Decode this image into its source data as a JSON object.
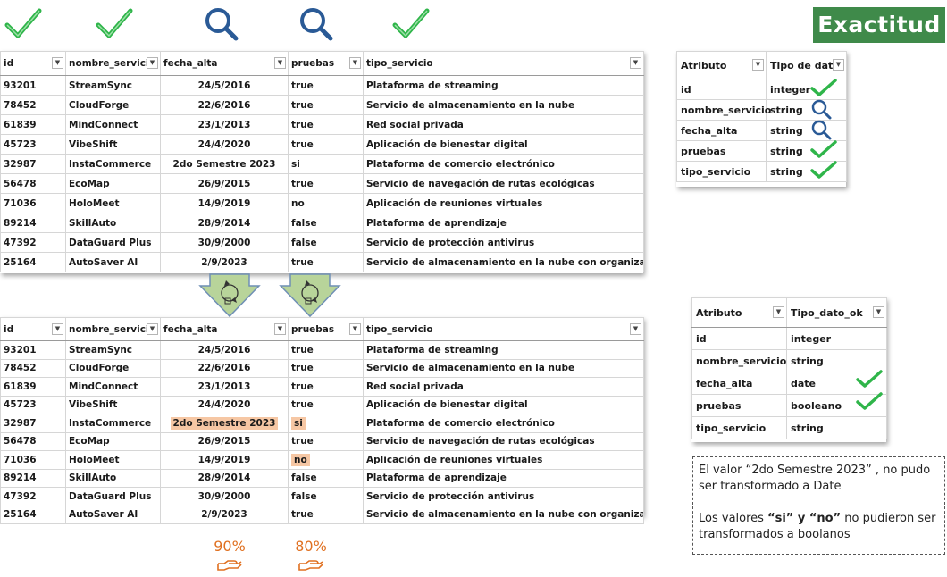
{
  "badge": "Exactitud",
  "header_icons": [
    "check-icon",
    "check-icon",
    "magnifier-icon",
    "magnifier-icon",
    "check-icon"
  ],
  "table": {
    "columns": [
      "id",
      "nombre_servicio",
      "fecha_alta",
      "pruebas",
      "tipo_servicio"
    ],
    "rows": [
      [
        "93201",
        "StreamSync",
        "24/5/2016",
        "true",
        "Plataforma de streaming"
      ],
      [
        "78452",
        "CloudForge",
        "22/6/2016",
        "true",
        "Servicio de almacenamiento en la nube"
      ],
      [
        "61839",
        "MindConnect",
        "23/1/2013",
        "true",
        "Red social privada"
      ],
      [
        "45723",
        "VibeShift",
        "24/4/2020",
        "true",
        "Aplicación de bienestar digital"
      ],
      [
        "32987",
        "InstaCommerce",
        "2do Semestre 2023",
        "si",
        "Plataforma de comercio electrónico"
      ],
      [
        "56478",
        "EcoMap",
        "26/9/2015",
        "true",
        "Servicio de navegación de rutas ecológicas"
      ],
      [
        "71036",
        "HoloMeet",
        "14/9/2019",
        "no",
        "Aplicación de reuniones virtuales"
      ],
      [
        "89214",
        "SkillAuto",
        "28/9/2014",
        "false",
        "Plataforma de aprendizaje"
      ],
      [
        "47392",
        "DataGuard Plus",
        "30/9/2000",
        "false",
        "Servicio de protección antivirus"
      ],
      [
        "25164",
        "AutoSaver AI",
        "2/9/2023",
        "true",
        "Servicio de almacenamiento en la nube con organizador AI"
      ]
    ]
  },
  "attr_before": {
    "headers": [
      "Atributo",
      "Tipo de dato"
    ],
    "rows": [
      {
        "attr": "id",
        "type": "integer",
        "mark": "check-icon"
      },
      {
        "attr": "nombre_servicio",
        "type": "string",
        "mark": "magnifier-icon"
      },
      {
        "attr": "fecha_alta",
        "type": "string",
        "mark": "magnifier-icon"
      },
      {
        "attr": "pruebas",
        "type": "string",
        "mark": "check-icon"
      },
      {
        "attr": "tipo_servicio",
        "type": "string",
        "mark": "check-icon"
      }
    ]
  },
  "attr_after": {
    "headers": [
      "Atributo",
      "Tipo_dato_ok"
    ],
    "rows": [
      {
        "attr": "id",
        "type": "integer",
        "mark": ""
      },
      {
        "attr": "nombre_servicio",
        "type": "string",
        "mark": ""
      },
      {
        "attr": "fecha_alta",
        "type": "date",
        "mark": "check-icon"
      },
      {
        "attr": "pruebas",
        "type": "booleano",
        "mark": "check-icon"
      },
      {
        "attr": "tipo_servicio",
        "type": "string",
        "mark": ""
      }
    ]
  },
  "note": {
    "line1": "El valor “2do Semestre 2023” , no pudo ser transformado a Date",
    "line2_pre": "Los valores ",
    "line2_bold": "“si” y “no”",
    "line2_post": " no pudieron ser transformados a boolanos"
  },
  "percent_fecha": "90%",
  "percent_pruebas": "80%",
  "colors": {
    "badge": "#3f8a4a",
    "check": "#2fb54a",
    "magnifier": "#2a5a96",
    "highlight": "#f6c7a4",
    "percent": "#e07020",
    "arrow": "#b8d49a"
  }
}
